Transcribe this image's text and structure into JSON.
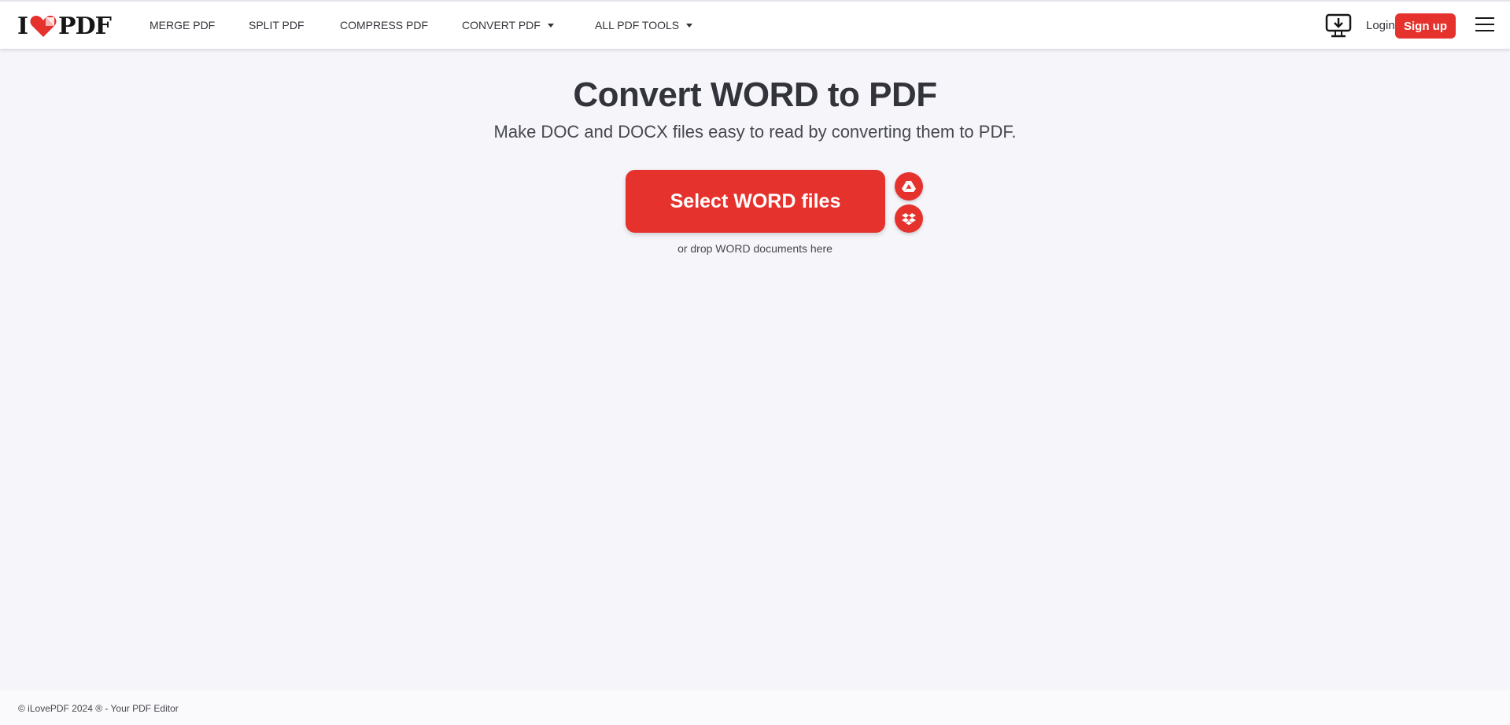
{
  "header": {
    "logo": {
      "left": "I",
      "right": "PDF",
      "heart_color": "#e5322d"
    },
    "nav": [
      {
        "label": "MERGE PDF",
        "dropdown": false
      },
      {
        "label": "SPLIT PDF",
        "dropdown": false
      },
      {
        "label": "COMPRESS PDF",
        "dropdown": false
      },
      {
        "label": "CONVERT PDF",
        "dropdown": true
      },
      {
        "label": "ALL PDF TOOLS",
        "dropdown": true
      }
    ],
    "desktop_icon": "desktop-download-icon",
    "login_label": "Login",
    "signup_label": "Sign up",
    "menu_icon": "hamburger-menu-icon"
  },
  "main": {
    "title": "Convert WORD to PDF",
    "subtitle": "Make DOC and DOCX files easy to read by converting them to PDF.",
    "select_button_label": "Select WORD files",
    "cloud_buttons": [
      {
        "name": "google-drive",
        "icon": "google-drive-icon"
      },
      {
        "name": "dropbox",
        "icon": "dropbox-icon"
      }
    ],
    "drop_hint": "or drop WORD documents here"
  },
  "footer": {
    "copyright": "© iLovePDF 2024 ® - Your PDF Editor"
  },
  "colors": {
    "brand_red": "#e5322d",
    "background": "#f5f5fa",
    "text": "#33333b"
  }
}
